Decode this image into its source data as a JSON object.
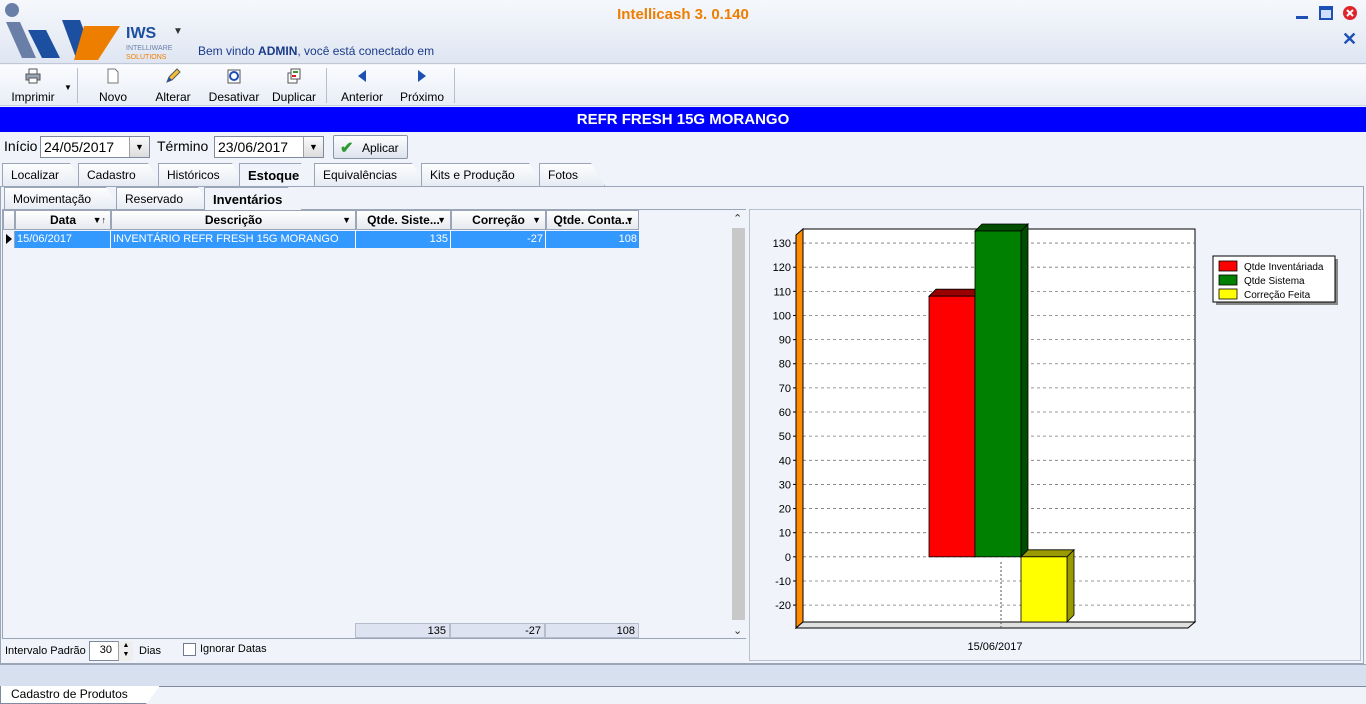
{
  "app": {
    "title": "Intellicash 3. 0.140",
    "brand": "IWS",
    "brand_sub1": "INTELLIWARE",
    "brand_sub2": "SOLUTIONS",
    "welcome_prefix": "Bem vindo ",
    "welcome_user": "ADMIN",
    "welcome_suffix": ", você está conectado em"
  },
  "toolbar": {
    "print": "Imprimir",
    "new": "Novo",
    "edit": "Alterar",
    "deactivate": "Desativar",
    "duplicate": "Duplicar",
    "previous": "Anterior",
    "next": "Próximo"
  },
  "product": {
    "name": "REFR FRESH 15G MORANGO"
  },
  "filter": {
    "start_label": "Início",
    "start_value": "24/05/2017",
    "end_label": "Término",
    "end_value": "23/06/2017",
    "apply_label": "Aplicar"
  },
  "tabs_main": [
    "Localizar",
    "Cadastro",
    "Históricos",
    "Estoque",
    "Equivalências",
    "Kits e Produção",
    "Fotos"
  ],
  "tabs_sub": [
    "Movimentação",
    "Reservado",
    "Inventários"
  ],
  "grid": {
    "columns": [
      "Data",
      "Descrição",
      "Qtde. Siste...",
      "Correção",
      "Qtde. Conta..."
    ],
    "rows": [
      {
        "date": "15/06/2017",
        "description": "INVENTÁRIO REFR FRESH 15G MORANGO",
        "system_qty": "135",
        "correction": "-27",
        "counted_qty": "108"
      }
    ],
    "totals": {
      "system_qty": "135",
      "correction": "-27",
      "counted_qty": "108"
    }
  },
  "bottom": {
    "interval_label": "Intervalo Padrão",
    "interval_value": "30",
    "days_label": "Dias",
    "ignore_dates_label": "Ignorar Datas"
  },
  "status": {
    "window_tab": "Cadastro de Produtos"
  },
  "colors": {
    "accent_orange": "#ee7e00",
    "header_blue": "#0000ff",
    "selection": "#3399ff"
  },
  "chart_data": {
    "type": "bar",
    "categories": [
      "15/06/2017"
    ],
    "series": [
      {
        "name": "Qtde Inventáriada",
        "values": [
          108
        ],
        "color": "#ff0000"
      },
      {
        "name": "Qtde Sistema",
        "values": [
          135
        ],
        "color": "#008000"
      },
      {
        "name": "Correção Feita",
        "values": [
          -27
        ],
        "color": "#ffff00"
      }
    ],
    "ylim": [
      -27,
      135
    ],
    "yticks": [
      -20,
      -10,
      0,
      10,
      20,
      30,
      40,
      50,
      60,
      70,
      80,
      90,
      100,
      110,
      120,
      130
    ],
    "grid": true,
    "legend_position": "top-right"
  }
}
